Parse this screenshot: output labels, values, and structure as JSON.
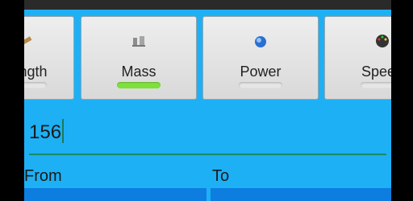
{
  "categories": [
    {
      "label": "Length",
      "icon": "ruler-icon",
      "active": false
    },
    {
      "label": "Mass",
      "icon": "weights-icon",
      "active": true
    },
    {
      "label": "Power",
      "icon": "power-icon",
      "active": false
    },
    {
      "label": "Speed",
      "icon": "speedometer-icon",
      "active": false
    }
  ],
  "input": {
    "value": "156"
  },
  "converter": {
    "from_label": "From",
    "to_label": "To"
  },
  "colors": {
    "background": "#1eb0f5",
    "active_indicator": "#7ee03a",
    "accent_line": "#1b8a63",
    "list_strip": "#0d7de0"
  }
}
